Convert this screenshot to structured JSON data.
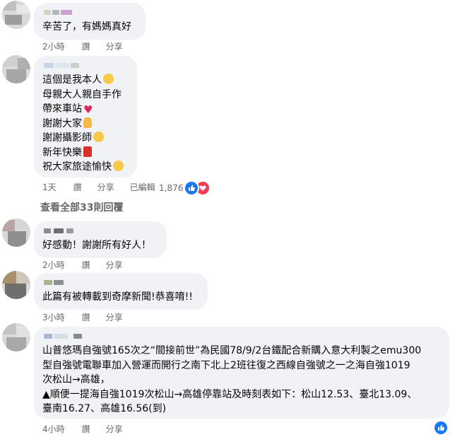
{
  "comments": [
    {
      "text": "辛苦了，有媽媽真好",
      "time": "2小時",
      "like_label": "讚",
      "share_label": "分享"
    },
    {
      "lines": [
        {
          "text": "這個是我本人",
          "emoji": "flushed-face"
        },
        {
          "text": "母親大人親自手作",
          "emoji": ""
        },
        {
          "text": "帶來車站",
          "emoji": "red-heart"
        },
        {
          "text": "謝謝大家",
          "emoji": "folded-hands"
        },
        {
          "text": "謝謝攝影師",
          "emoji": "pleading-face"
        },
        {
          "text": "新年快樂",
          "emoji": "red-envelope"
        },
        {
          "text": "祝大家旅途愉快",
          "emoji": "smiling-face"
        }
      ],
      "time": "1天",
      "like_label": "讚",
      "share_label": "分享",
      "edited_label": "已編輯",
      "reaction_count": "1,876"
    },
    {
      "text": "好感動！謝謝所有好人！",
      "time": "2小時",
      "like_label": "讚",
      "share_label": "分享"
    },
    {
      "text": "此篇有被轉載到奇摩新聞!恭喜唷!!",
      "time": "3小時",
      "like_label": "讚",
      "share_label": "分享"
    },
    {
      "lines": [
        "山普悠瑪自強號165次之“間接前世”為民國78/9/2台鐵配合新購入意大利製之emu300",
        "型自強號電聯車加入營運而開行之南下北上2班往復之西線自強號之一之海自強1019",
        "次松山→高雄，",
        "▲順便一提海自強1019次松山→高雄停靠站及時刻表如下：松山12.53、臺北13.09、",
        "臺南16.27、高雄16.56(到)"
      ],
      "time": "4小時",
      "like_label": "讚",
      "share_label": "分享"
    }
  ],
  "view_all_replies": "查看全部33則回覆",
  "colors": {
    "bubble": "#f0f2f5",
    "meta_text": "#65676b",
    "like_blue": "#1877f2",
    "love_red": "#f33e58"
  }
}
